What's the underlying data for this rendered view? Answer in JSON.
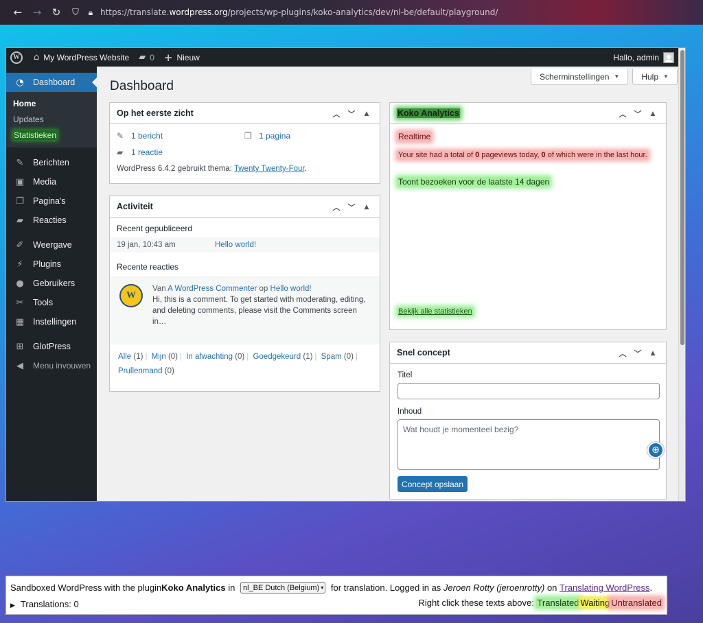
{
  "browser": {
    "url_prefix": "https://translate.",
    "url_host": "wordpress.org",
    "url_path": "/projects/wp-plugins/koko-analytics/dev/nl-be/default/playground/"
  },
  "adminbar": {
    "site_name": "My WordPress Website",
    "comments_count": "0",
    "new_label": "Nieuw",
    "greeting": "Hallo, admin"
  },
  "sidebar": {
    "dashboard": "Dashboard",
    "sub": {
      "home": "Home",
      "updates": "Updates",
      "stats": "Statistieken"
    },
    "items": [
      "Berichten",
      "Media",
      "Pagina's",
      "Reacties",
      "Weergave",
      "Plugins",
      "Gebruikers",
      "Tools",
      "Instellingen",
      "GlotPress"
    ],
    "collapse": "Menu invouwen"
  },
  "screen_options": {
    "screen": "Scherminstellingen",
    "help": "Hulp"
  },
  "page_title": "Dashboard",
  "glance": {
    "title": "Op het eerste zicht",
    "posts": "1 bericht",
    "pages": "1 pagina",
    "comments": "1 reactie",
    "version_text": "WordPress 6.4.2 gebruikt thema: ",
    "theme": "Twenty Twenty-Four",
    "dot": "."
  },
  "activity": {
    "title": "Activiteit",
    "recent_published": "Recent gepubliceerd",
    "pub_date": "19 jan, 10:43 am",
    "pub_title": "Hello world!",
    "recent_comments": "Recente reacties",
    "comment_from": "Van ",
    "commenter": "A WordPress Commenter",
    "on": " op ",
    "comment_post": "Hello world!",
    "comment_text": "Hi, this is a comment. To get started with moderating, editing, and deleting comments, please visit the Comments screen in…",
    "filters": {
      "all": "Alle",
      "all_count": "(1)",
      "mine": "Mijn",
      "mine_count": "(0)",
      "pending": "In afwachting",
      "pending_count": "(0)",
      "approved": "Goedgekeurd",
      "approved_count": "(1)",
      "spam": "Spam",
      "spam_count": "(0)",
      "trash": "Prullenmand",
      "trash_count": "(0)"
    }
  },
  "koko": {
    "title": "Koko Analytics",
    "realtime": "Realtime",
    "realtime_text_1": "Your site had a total of ",
    "pageviews_today": "0",
    "realtime_text_2": " pageviews today, ",
    "last_hour": "0",
    "realtime_text_3": " of which were in the last hour.",
    "visits_label": "Toont bezoeken voor de laatste 14 dagen",
    "all_stats": "Bekijk alle statistieken"
  },
  "draft": {
    "title": "Snel concept",
    "title_label": "Titel",
    "content_label": "Inhoud",
    "content_placeholder": "Wat houdt je momenteel bezig?",
    "save": "Concept opslaan"
  },
  "footer": {
    "t1": "Sandboxed WordPress with the plugin ",
    "plugin": "Koko Analytics",
    "t2": " in ",
    "locale": "nl_BE Dutch (Belgium)",
    "t3": " for translation. Logged in as ",
    "user": "Jeroen Rotty (jeroenrotty)",
    "t4": " on ",
    "link": "Translating WordPress",
    "t5": ".",
    "translations": "Translations: 0",
    "legend_prefix": "Right click these texts above: ",
    "legend_translated": "Translated",
    "legend_waiting": "Waiting",
    "legend_untranslated": "Untranslated"
  },
  "colors": {
    "admin_bar": "#1d2327",
    "accent": "#2271b1",
    "translated": "#5ccf5c",
    "waiting": "#eeea4a",
    "untranslated": "#f7a8a8"
  },
  "icons": [
    "back-arrow-icon",
    "forward-arrow-icon",
    "reload-icon",
    "shield-icon",
    "lock-icon",
    "wordpress-logo-icon",
    "home-icon",
    "comment-bubble-icon",
    "plus-icon",
    "dashboard-gauge-icon",
    "pin-icon",
    "media-icon",
    "pages-icon",
    "comments-icon",
    "brush-icon",
    "plugin-icon",
    "users-icon",
    "wrench-icon",
    "settings-icon",
    "glotpress-icon",
    "collapse-icon",
    "globe-icon"
  ]
}
